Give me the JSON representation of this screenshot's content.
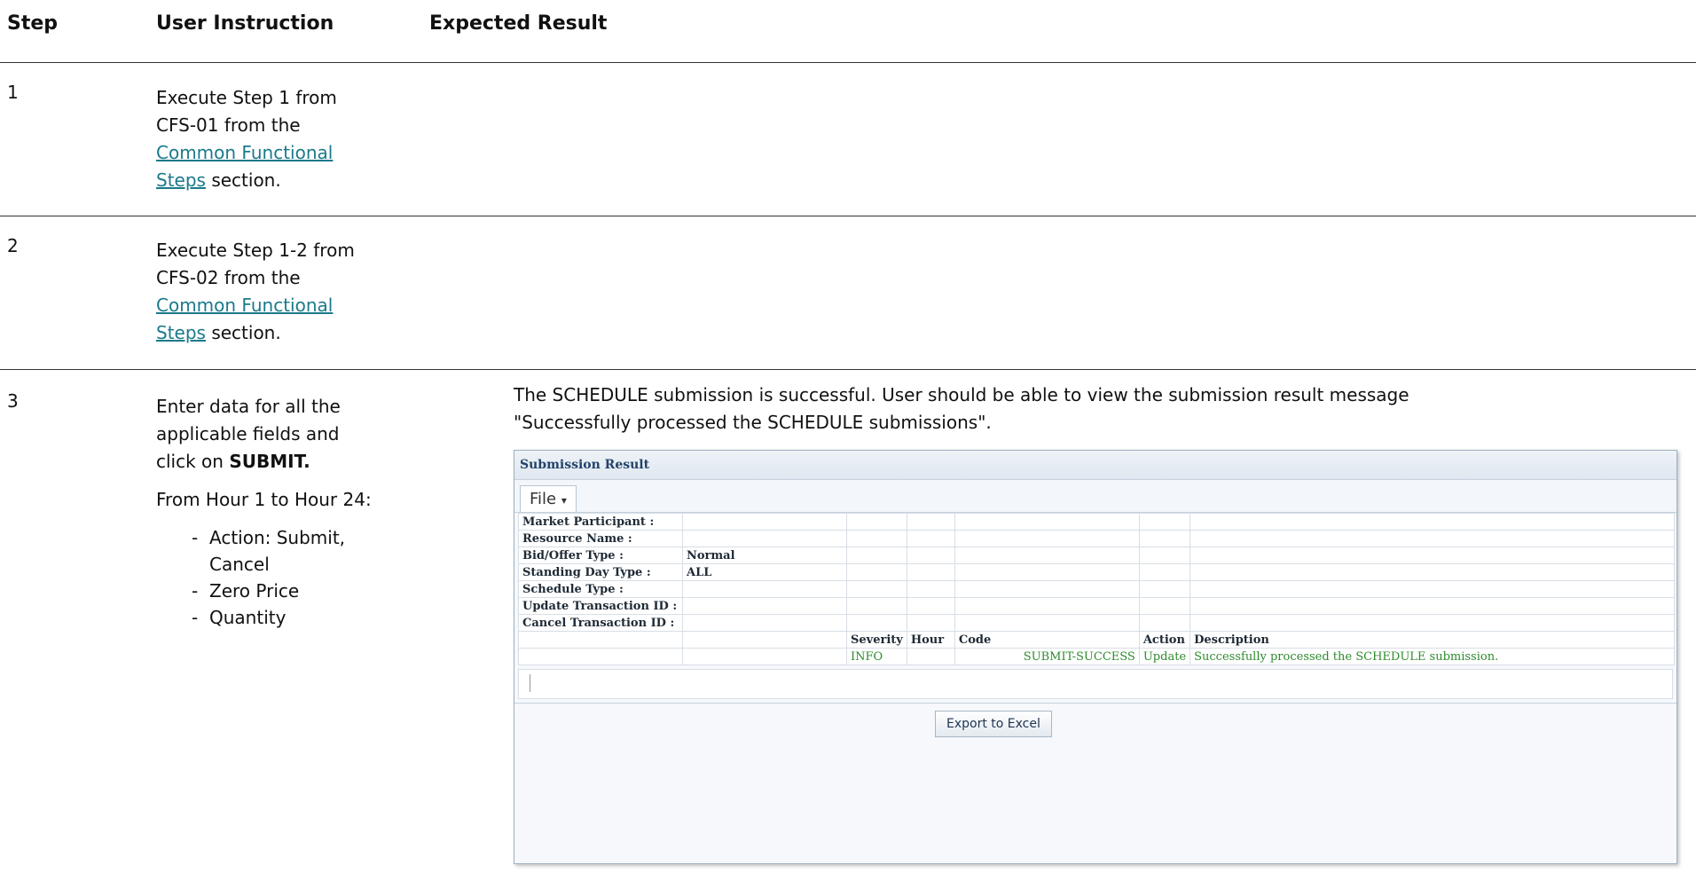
{
  "headers": {
    "step": "Step",
    "instruction": "User Instruction",
    "expected": "Expected Result"
  },
  "rows": [
    {
      "step": "1",
      "line1": "Execute Step 1 from",
      "line2": "CFS-01 from the",
      "link_a": "Common Functional",
      "link_b": "Steps",
      "tail": " section."
    },
    {
      "step": "2",
      "line1": "Execute Step 1-2 from",
      "line2": "CFS-02 from the",
      "link_a": "Common Functional",
      "link_b": "Steps",
      "tail": " section."
    },
    {
      "step": "3",
      "line1": "Enter data for all the",
      "line2": "applicable fields and",
      "line3_pre": "click on ",
      "line3_bold": "SUBMIT.",
      "range": "From Hour 1 to Hour 24:",
      "options": [
        "Action: Submit,",
        "Cancel",
        "Zero Price",
        "Quantity"
      ],
      "dash": "-",
      "expected_line1": "The SCHEDULE submission is successful. User should be able to view the submission result message",
      "expected_line2": "\"Successfully processed the SCHEDULE submissions\"."
    }
  ],
  "panel": {
    "title": "Submission Result",
    "file_menu": "File",
    "file_caret": "▾",
    "fields": [
      {
        "label": "Market Participant :",
        "value": ""
      },
      {
        "label": "Resource Name :",
        "value": ""
      },
      {
        "label": "Bid/Offer Type :",
        "value": "Normal"
      },
      {
        "label": "Standing Day Type :",
        "value": "ALL"
      },
      {
        "label": "Schedule Type :",
        "value": ""
      },
      {
        "label": "Update Transaction ID :",
        "value": ""
      },
      {
        "label": "Cancel Transaction ID :",
        "value": ""
      }
    ],
    "columns": {
      "severity": "Severity",
      "hour": "Hour",
      "code": "Code",
      "action": "Action",
      "description": "Description"
    },
    "result": {
      "severity": "INFO",
      "hour": "",
      "code": "SUBMIT-SUCCESS",
      "action": "Update",
      "description": "Successfully processed the SCHEDULE submission."
    },
    "export_label": "Export to Excel"
  }
}
